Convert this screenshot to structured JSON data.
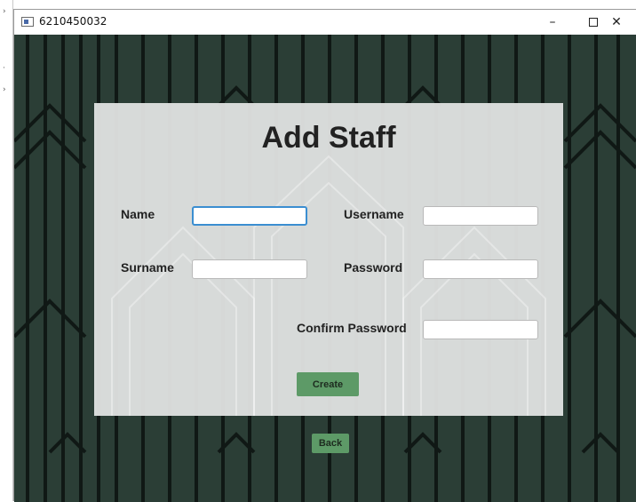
{
  "window": {
    "title": "6210450032",
    "minimize_glyph": "–",
    "close_glyph": "✕"
  },
  "form": {
    "heading": "Add Staff",
    "name_label": "Name",
    "surname_label": "Surname",
    "username_label": "Username",
    "password_label": "Password",
    "confirm_password_label": "Confirm Password",
    "name_value": "",
    "surname_value": "",
    "username_value": "",
    "password_value": "",
    "confirm_password_value": ""
  },
  "buttons": {
    "create_label": "Create",
    "back_label": "Back"
  },
  "colors": {
    "background_dark_green": "#2b3e36",
    "card": "#e2e4e3",
    "button_green": "#5d9a67",
    "focus_blue": "#3b8ed1"
  },
  "icons": {
    "app": "window-app-icon",
    "minimize": "minimize-icon",
    "maximize": "maximize-icon",
    "close": "close-icon"
  }
}
